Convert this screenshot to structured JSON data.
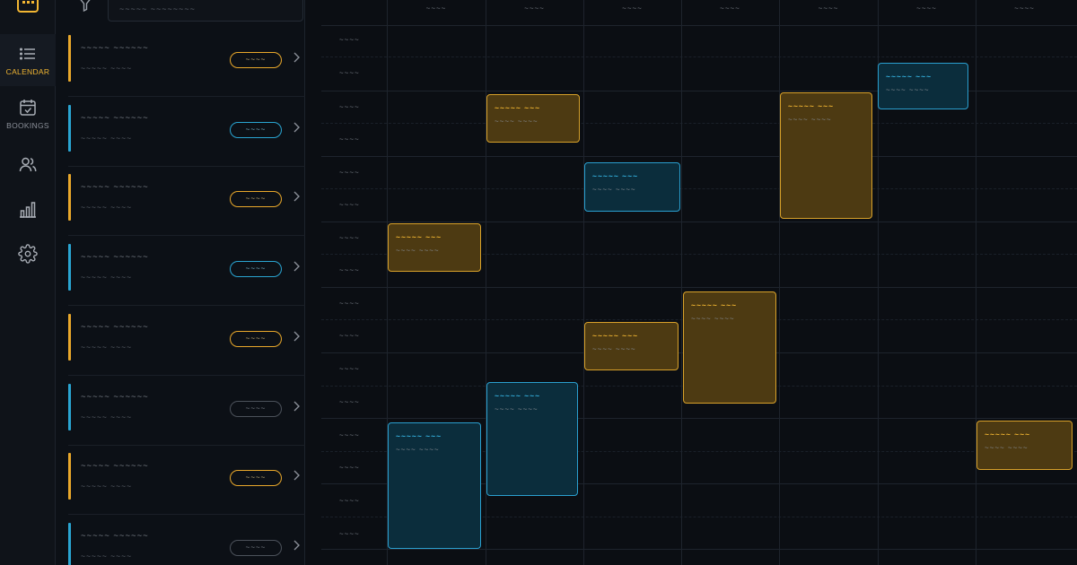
{
  "nav": {
    "items": [
      {
        "label": "CALENDAR",
        "icon": "list-icon",
        "active": true
      },
      {
        "label": "BOOKINGS",
        "icon": "calendar-check-icon",
        "active": false
      },
      {
        "label": "",
        "icon": "users-icon",
        "active": false
      },
      {
        "label": "",
        "icon": "bar-chart-icon",
        "active": false
      },
      {
        "label": "",
        "icon": "gear-icon",
        "active": false
      }
    ]
  },
  "filter": {
    "placeholder": "~~~~~ ~~~~~~~~"
  },
  "list": [
    {
      "title": "~~~~~ ~~~~~~",
      "sub": "~~~~~ ~~~~",
      "pill": "~~~~",
      "color": "amber"
    },
    {
      "title": "~~~~~ ~~~~~~",
      "sub": "~~~~~ ~~~~",
      "pill": "~~~~",
      "color": "blue"
    },
    {
      "title": "~~~~~ ~~~~~~",
      "sub": "~~~~~ ~~~~",
      "pill": "~~~~",
      "color": "amber"
    },
    {
      "title": "~~~~~ ~~~~~~",
      "sub": "~~~~~ ~~~~",
      "pill": "~~~~",
      "color": "blue"
    },
    {
      "title": "~~~~~ ~~~~~~",
      "sub": "~~~~~ ~~~~",
      "pill": "~~~~",
      "color": "amber"
    },
    {
      "title": "~~~~~ ~~~~~~",
      "sub": "~~~~~ ~~~~",
      "pill": "~~~~",
      "color": "gray"
    },
    {
      "title": "~~~~~ ~~~~~~",
      "sub": "~~~~~ ~~~~",
      "pill": "~~~~",
      "color": "amber"
    },
    {
      "title": "~~~~~ ~~~~~~",
      "sub": "~~~~~ ~~~~",
      "pill": "~~~~",
      "color": "gray"
    }
  ],
  "calendar": {
    "days": [
      "~~~~",
      "~~~~",
      "~~~~",
      "~~~~",
      "~~~~",
      "~~~~",
      "~~~~"
    ],
    "times": [
      "~~~~",
      "~~~~",
      "~~~~",
      "~~~~",
      "~~~~",
      "~~~~",
      "~~~~",
      "~~~~",
      "~~~~",
      "~~~~",
      "~~~~",
      "~~~~",
      "~~~~",
      "~~~~",
      "~~~~",
      "~~~~"
    ],
    "events": [
      {
        "title": "~~~~~ ~~~",
        "sub": "~~~~ ~~~~",
        "color": "amber"
      },
      {
        "title": "~~~~~ ~~~",
        "sub": "~~~~ ~~~~",
        "color": "amber"
      },
      {
        "title": "~~~~~ ~~~",
        "sub": "~~~~ ~~~~",
        "color": "blue"
      },
      {
        "title": "~~~~~ ~~~",
        "sub": "~~~~ ~~~~",
        "color": "amber"
      },
      {
        "title": "~~~~~ ~~~",
        "sub": "~~~~ ~~~~",
        "color": "blue"
      },
      {
        "title": "~~~~~ ~~~",
        "sub": "~~~~ ~~~~",
        "color": "amber"
      },
      {
        "title": "~~~~~ ~~~",
        "sub": "~~~~ ~~~~",
        "color": "amber"
      },
      {
        "title": "~~~~~ ~~~",
        "sub": "~~~~ ~~~~",
        "color": "blue"
      },
      {
        "title": "~~~~~ ~~~",
        "sub": "~~~~ ~~~~",
        "color": "blue"
      },
      {
        "title": "~~~~~ ~~~",
        "sub": "~~~~ ~~~~",
        "color": "amber"
      }
    ]
  },
  "colors": {
    "amber": "#f2b632",
    "blue": "#2aa5d2",
    "background": "#0b0e13"
  }
}
